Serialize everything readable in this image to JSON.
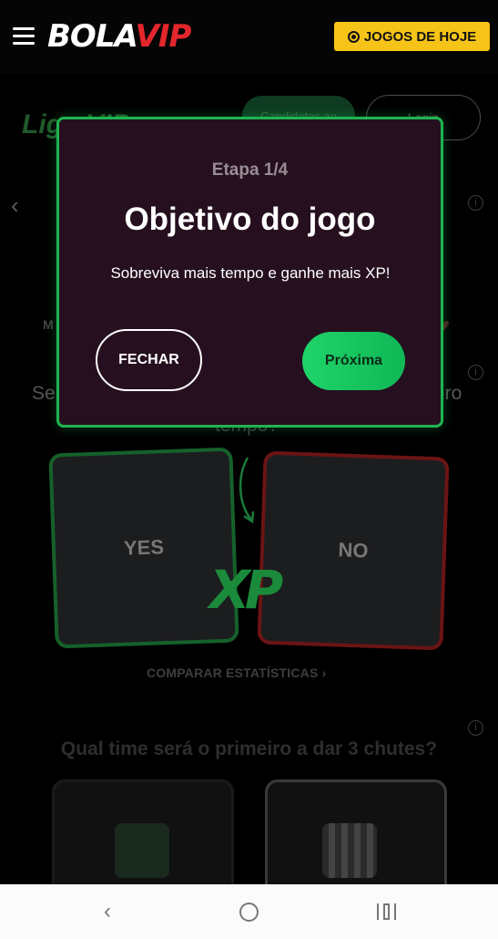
{
  "header": {
    "logo_bola": "BOLA",
    "logo_vip": "VIP",
    "jogos_button": "JOGOS DE HOJE"
  },
  "background": {
    "liga_logo": "Liga VIP",
    "pill_green": "Candidatos ao",
    "pill_outline": "Login",
    "letter_m": "M",
    "text_se": "Se",
    "text_iro": "iro",
    "text_tempo": "tempo?",
    "card_yes": "YES",
    "card_no": "NO",
    "xp_logo": "XP",
    "compare_link": "COMPARAR ESTATÍSTICAS",
    "question": "Qual time será o primeiro a dar 3 chutes?"
  },
  "modal": {
    "step": "Etapa 1/4",
    "title": "Objetivo do jogo",
    "description": "Sobreviva mais tempo e ganhe mais XP!",
    "close_button": "FECHAR",
    "next_button": "Próxima"
  },
  "colors": {
    "accent_green": "#1eb54f",
    "brand_red": "#e3262c",
    "header_yellow": "#f6c419",
    "modal_bg": "#26101f"
  }
}
